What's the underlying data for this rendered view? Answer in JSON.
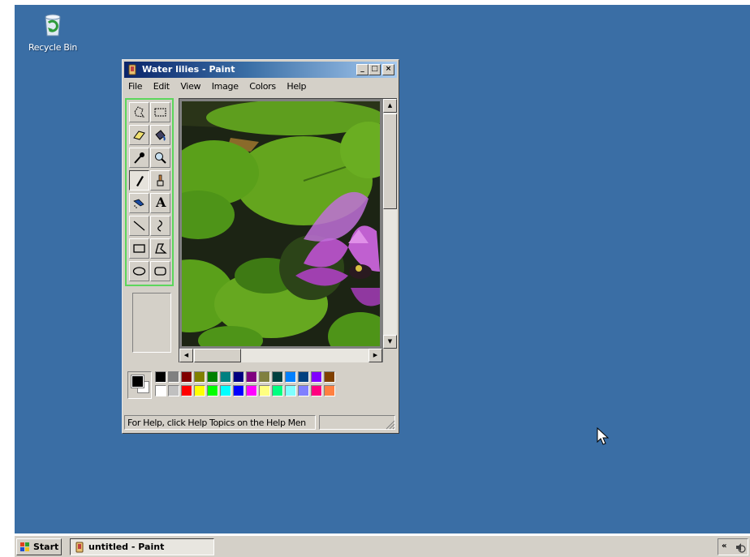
{
  "desktop": {
    "background": "#3a6ea5",
    "icons": [
      {
        "label": "Recycle Bin",
        "icon": "recycle-bin-icon"
      }
    ]
  },
  "paint_window": {
    "title": "Water lilies - Paint",
    "controls": {
      "minimize": "_",
      "maximize": "□",
      "close": "×"
    },
    "menu": [
      "File",
      "Edit",
      "View",
      "Image",
      "Colors",
      "Help"
    ],
    "tools": [
      "free-form-select-icon",
      "select-icon",
      "eraser-icon",
      "fill-with-color-icon",
      "pick-color-icon",
      "magnifier-icon",
      "pencil-icon",
      "brush-icon",
      "airbrush-icon",
      "text-icon",
      "line-icon",
      "curve-icon",
      "rectangle-icon",
      "polygon-icon",
      "ellipse-icon",
      "rounded-rectangle-icon"
    ],
    "selected_tool": "pencil-icon",
    "text_tool_glyph": "A",
    "scroll_arrows": {
      "up": "▲",
      "down": "▼",
      "left": "◀",
      "right": "▶"
    },
    "palette": {
      "foreground": "#000000",
      "background": "#ffffff",
      "top_row": [
        "#000000",
        "#808080",
        "#800000",
        "#808000",
        "#008000",
        "#008080",
        "#000080",
        "#800080",
        "#808040",
        "#004040",
        "#0080ff",
        "#004080",
        "#8000ff",
        "#804000"
      ],
      "bottom_row": [
        "#ffffff",
        "#c0c0c0",
        "#ff0000",
        "#ffff00",
        "#00ff00",
        "#00ffff",
        "#0000ff",
        "#ff00ff",
        "#ffff80",
        "#00ff80",
        "#80ffff",
        "#8080ff",
        "#ff0080",
        "#ff8040"
      ]
    },
    "status_text": "For Help, click Help Topics on the Help Men"
  },
  "taskbar": {
    "start_label": "Start",
    "tasks": [
      {
        "label": "untitled - Paint",
        "icon": "paint-app-icon"
      }
    ],
    "tray_expand": "«",
    "tray_icons": [
      "volume-icon"
    ]
  }
}
